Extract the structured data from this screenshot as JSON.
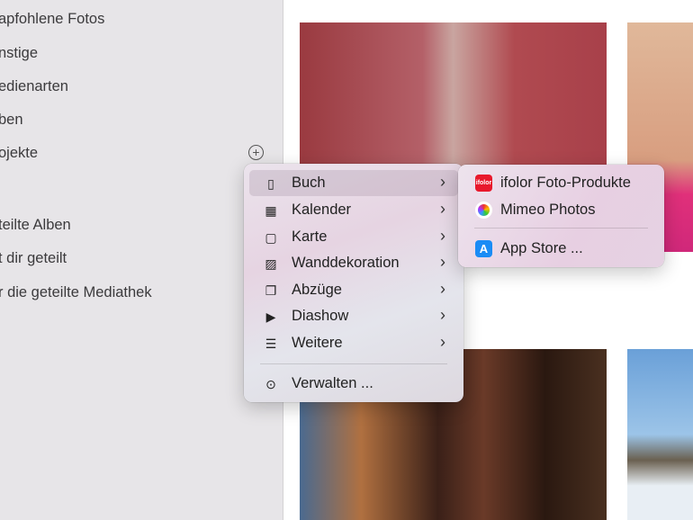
{
  "sidebar": {
    "items": [
      "apfohlene Fotos",
      "nstige",
      "edienarten",
      "ben",
      "ojekte",
      "teilte Alben",
      "t dir geteilt",
      "r die geteilte Mediathek"
    ],
    "add_icon": "plus-circle-icon"
  },
  "menu": {
    "items": [
      {
        "label": "Buch",
        "icon": "book-icon"
      },
      {
        "label": "Kalender",
        "icon": "calendar-icon"
      },
      {
        "label": "Karte",
        "icon": "card-icon"
      },
      {
        "label": "Wanddekoration",
        "icon": "wall-photo-icon"
      },
      {
        "label": "Abzüge",
        "icon": "prints-icon"
      },
      {
        "label": "Diashow",
        "icon": "slideshow-icon"
      },
      {
        "label": "Weitere",
        "icon": "stack-icon"
      }
    ],
    "manage": "Verwalten ..."
  },
  "submenu": {
    "items": [
      {
        "label": "ifolor Foto-Produkte",
        "icon_text": "ifolor"
      },
      {
        "label": "Mimeo Photos"
      }
    ],
    "app_store": "App Store ..."
  },
  "colors": {
    "ifolor": "#e8192c",
    "appstore": "#1a8cf5"
  }
}
